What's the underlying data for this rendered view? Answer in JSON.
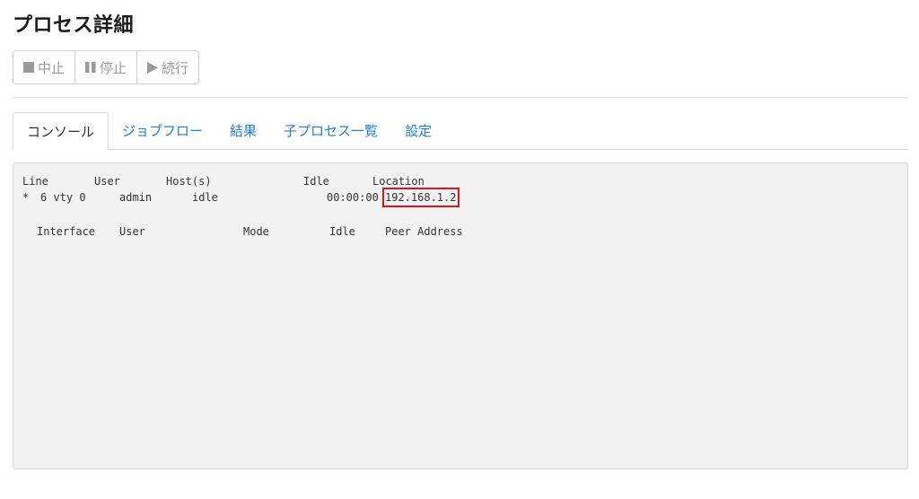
{
  "page": {
    "title": "プロセス詳細"
  },
  "toolbar": {
    "buttons": [
      {
        "label": "中止",
        "icon": "stop-icon"
      },
      {
        "label": "停止",
        "icon": "pause-icon"
      },
      {
        "label": "続行",
        "icon": "play-icon"
      }
    ]
  },
  "tabs": [
    {
      "label": "コンソール",
      "active": true
    },
    {
      "label": "ジョブフロー",
      "active": false
    },
    {
      "label": "結果",
      "active": false
    },
    {
      "label": "子プロセス一覧",
      "active": false
    },
    {
      "label": "設定",
      "active": false
    }
  ],
  "console": {
    "header1": {
      "line": "Line",
      "user": "User",
      "hosts": "Host(s)",
      "idle": "Idle",
      "location": "Location"
    },
    "row1": {
      "marker": "*",
      "line": "6 vty 0",
      "user": "admin",
      "hosts": "idle",
      "idle": "00:00:00",
      "location": "192.168.1.2"
    },
    "header2": {
      "interface": "Interface",
      "user": "User",
      "mode": "Mode",
      "idle": "Idle",
      "peer": "Peer Address"
    }
  },
  "colors": {
    "link": "#1e7fd6",
    "highlight": "#e0141e",
    "console_bg": "#f2f2f2"
  }
}
